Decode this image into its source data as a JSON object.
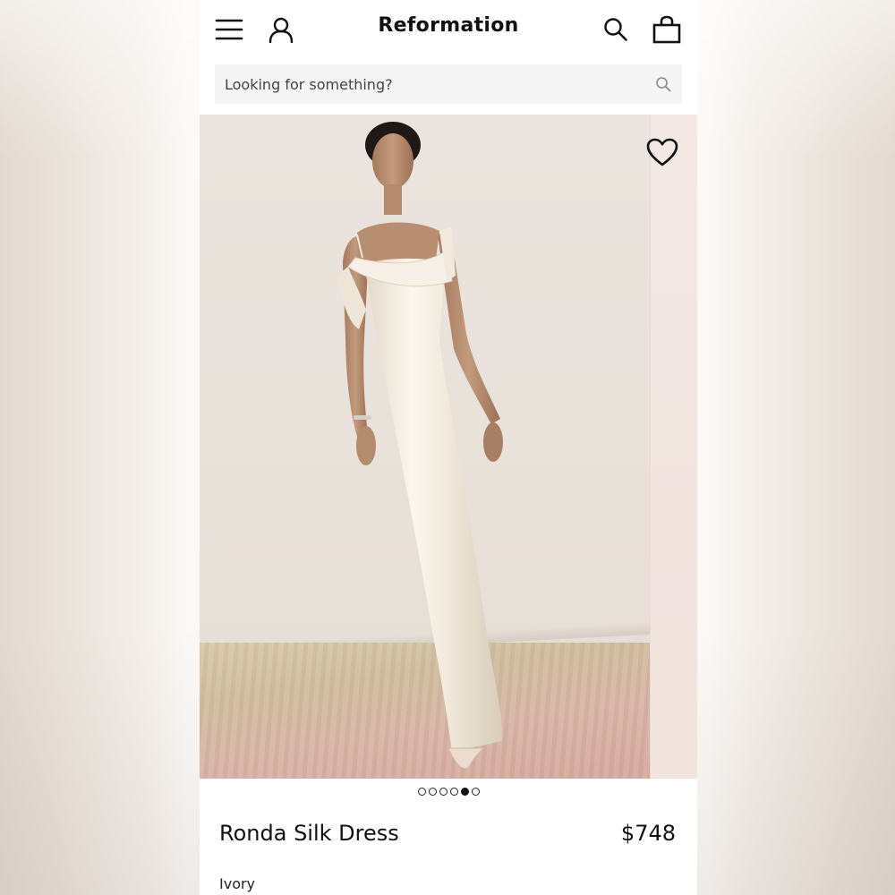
{
  "header": {
    "brand": "Reformation",
    "icons": [
      "menu-icon",
      "account-icon",
      "search-icon",
      "bag-icon"
    ]
  },
  "search": {
    "placeholder": "Looking for something?"
  },
  "gallery": {
    "image_count": 6,
    "active_index": 4
  },
  "product": {
    "name": "Ronda Silk Dress",
    "price": "$748",
    "color": "Ivory"
  },
  "colors": {
    "text": "#111111",
    "search_bg": "#f5f5f5",
    "dress": "#f3ece0"
  }
}
